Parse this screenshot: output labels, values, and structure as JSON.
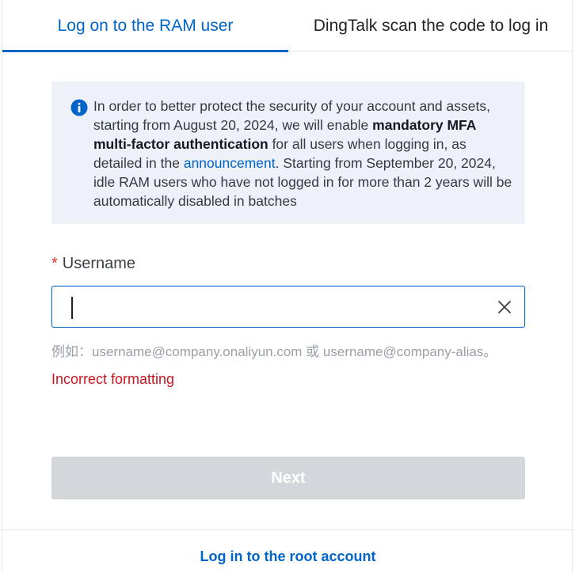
{
  "tabs": {
    "ram_user": "Log on to the RAM user",
    "dingtalk": "DingTalk scan the code to log in"
  },
  "notice": {
    "icon": "info-icon",
    "part1": "In order to better protect the security of your account and assets, starting from August 20, 2024, we will enable ",
    "bold": "mandatory MFA multi-factor authentication",
    "part2": " for all users when logging in, as detailed in the ",
    "link": "announcement",
    "part3": ". Starting from September 20, 2024, idle RAM users who have not logged in for more than 2 years will be automatically disabled in batches"
  },
  "username": {
    "required_mark": "*",
    "label": "Username",
    "value": "",
    "hint": "例如：username@company.onaliyun.com 或 username@company-alias。",
    "error": "Incorrect formatting"
  },
  "buttons": {
    "next": "Next"
  },
  "footer": {
    "root_link": "Log in to the root account"
  },
  "colors": {
    "accent": "#0064c8",
    "error": "#c8161d",
    "disabled_button": "#d3d6da",
    "notice_bg": "#eef2f8"
  }
}
